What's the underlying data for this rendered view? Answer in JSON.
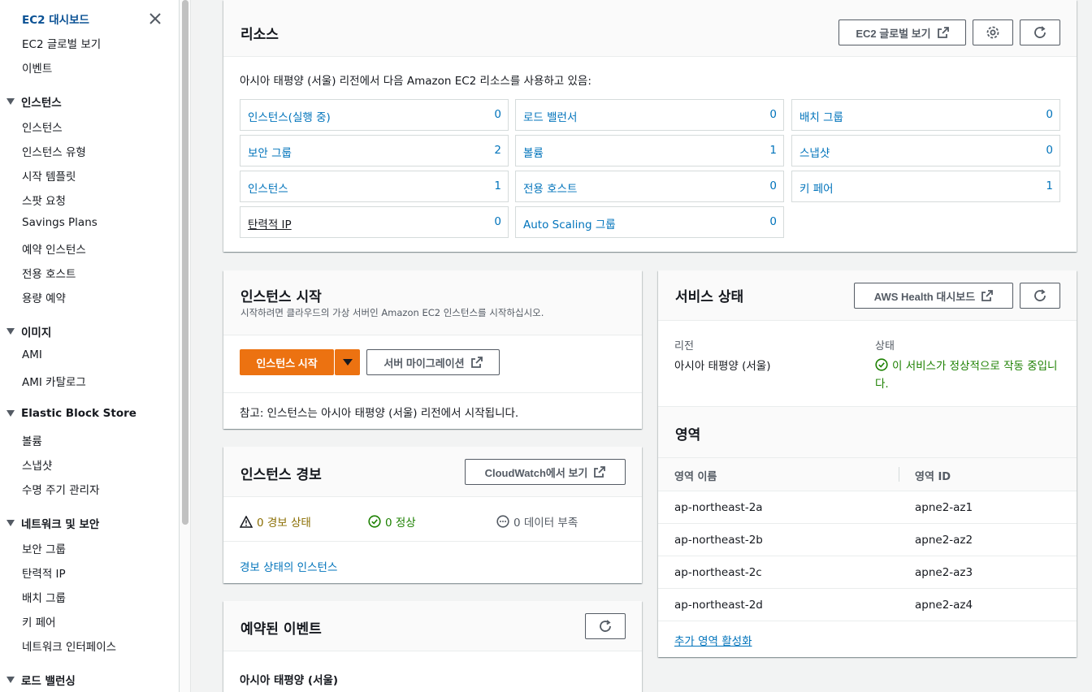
{
  "sidebar": {
    "top_items": [
      "EC2 대시보드",
      "EC2 글로벌 보기",
      "이벤트"
    ],
    "sections": [
      {
        "title": "인스턴스",
        "items": [
          "인스턴스",
          "인스턴스 유형",
          "시작 템플릿",
          "스팟 요청",
          "Savings Plans",
          "예약 인스턴스",
          "전용 호스트",
          "용량 예약"
        ]
      },
      {
        "title": "이미지",
        "items": [
          "AMI",
          "AMI 카탈로그"
        ]
      },
      {
        "title": "Elastic Block Store",
        "items": [
          "볼륨",
          "스냅샷",
          "수명 주기 관리자"
        ]
      },
      {
        "title": "네트워크 및 보안",
        "items": [
          "보안 그룹",
          "탄력적 IP",
          "배치 그룹",
          "키 페어",
          "네트워크 인터페이스"
        ]
      },
      {
        "title": "로드 밸런싱",
        "items": []
      }
    ]
  },
  "resources": {
    "title": "리소스",
    "global_view_button": "EC2 글로벌 보기",
    "description": "아시아 태평양 (서울) 리전에서 다음 Amazon EC2 리소스를 사용하고 있음:",
    "cells": [
      {
        "label": "인스턴스(실행 중)",
        "value": "0"
      },
      {
        "label": "로드 밸런서",
        "value": "0"
      },
      {
        "label": "배치 그룹",
        "value": "0"
      },
      {
        "label": "보안 그룹",
        "value": "2"
      },
      {
        "label": "볼륨",
        "value": "1"
      },
      {
        "label": "스냅샷",
        "value": "0"
      },
      {
        "label": "인스턴스",
        "value": "1"
      },
      {
        "label": "전용 호스트",
        "value": "0"
      },
      {
        "label": "키 페어",
        "value": "1"
      },
      {
        "label": "탄력적 IP",
        "value": "0"
      },
      {
        "label": "Auto Scaling 그룹",
        "value": "0"
      }
    ]
  },
  "launch": {
    "title": "인스턴스 시작",
    "subtitle": "시작하려면 클라우드의 가상 서버인 Amazon EC2 인스턴스를 시작하십시오.",
    "launch_button": "인스턴스 시작",
    "migrate_button": "서버 마이그레이션",
    "note": "참고: 인스턴스는 아시아 태평양 (서울) 리전에서 시작됩니다."
  },
  "alarms": {
    "title": "인스턴스 경보",
    "cloudwatch_button": "CloudWatch에서 보기",
    "alarm_state": "0 경보 상태",
    "ok_state": "0 정상",
    "insufficient_state": "0 데이터 부족",
    "link": "경보 상태의 인스턴스"
  },
  "events": {
    "title": "예약된 이벤트",
    "region_label": "아시아 태평양 (서울)"
  },
  "service_health": {
    "title": "서비스 상태",
    "health_button": "AWS Health 대시보드",
    "region_header": "리전",
    "region_value": "아시아 태평양 (서울)",
    "status_header": "상태",
    "status_line1": "이 서비스가 정상적으로 작동 중입니",
    "status_line2": "다."
  },
  "zones": {
    "title": "영역",
    "col_name": "영역 이름",
    "col_id": "영역 ID",
    "rows": [
      {
        "name": "ap-northeast-2a",
        "id": "apne2-az1"
      },
      {
        "name": "ap-northeast-2b",
        "id": "apne2-az2"
      },
      {
        "name": "ap-northeast-2c",
        "id": "apne2-az3"
      },
      {
        "name": "ap-northeast-2d",
        "id": "apne2-az4"
      }
    ],
    "enable_link": "추가 영역 활성화"
  },
  "colors": {
    "accent": "#0073bb",
    "primary": "#ec7211",
    "success": "#1d8102",
    "warning": "#8a6d00"
  }
}
